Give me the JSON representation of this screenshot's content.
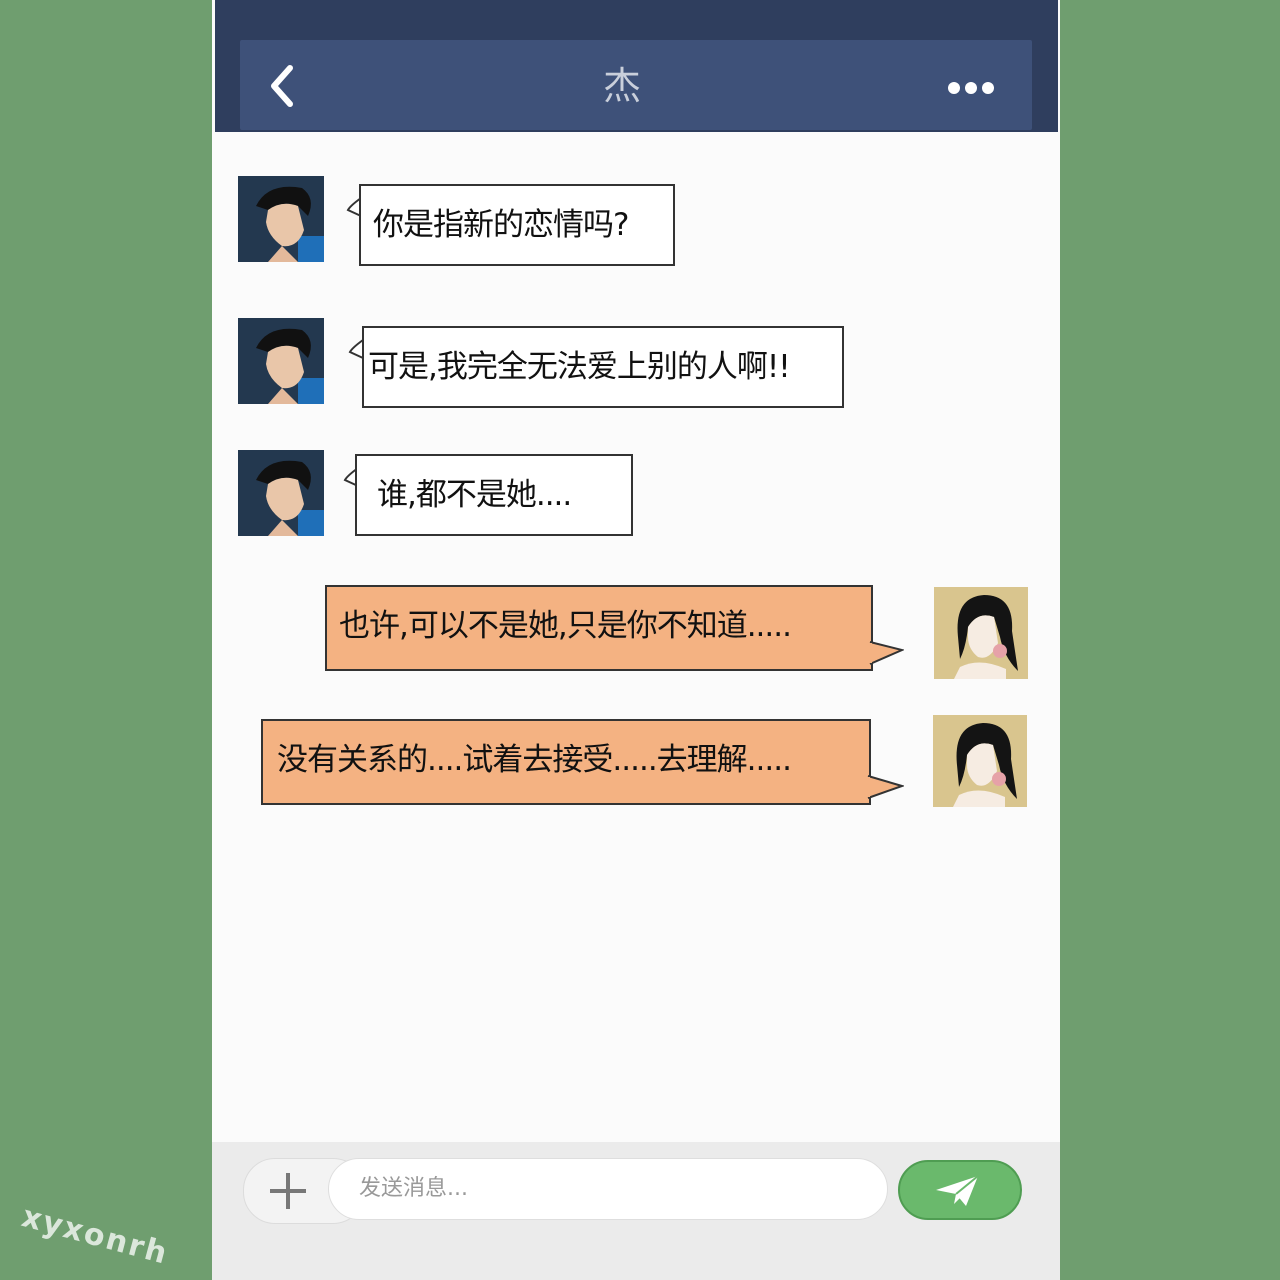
{
  "header": {
    "title": "杰"
  },
  "messages": [
    {
      "sender": "jie",
      "text": "你是指新的恋情吗?"
    },
    {
      "sender": "jie",
      "text": "可是,我完全无法爱上别的人啊!!"
    },
    {
      "sender": "jie",
      "text": "谁,都不是她...."
    },
    {
      "sender": "self",
      "text": "也许,可以不是她,只是你不知道....."
    },
    {
      "sender": "self",
      "text": "没有关系的....试着去接受.....去理解....."
    }
  ],
  "composer": {
    "placeholder": "发送消息..."
  },
  "watermark": "xyxonrh",
  "colors": {
    "background": "#6f9e6f",
    "header": "#3e5179",
    "my_bubble": "#f4b282",
    "send_button": "#6ab96c"
  },
  "icons": {
    "back": "chevron-left-icon",
    "more": "more-dots-icon",
    "add": "plus-icon",
    "send": "paper-plane-icon"
  }
}
